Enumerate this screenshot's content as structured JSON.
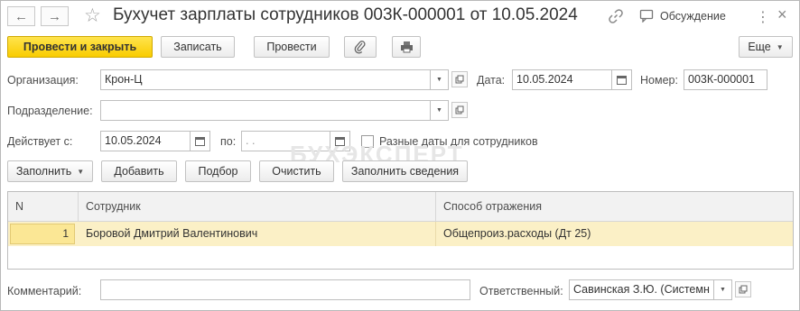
{
  "window": {
    "title": "Бухучет зарплаты сотрудников 003К-000001 от 10.05.2024",
    "discussion_label": "Обсуждение",
    "menu_dots": "⋮",
    "close_glyph": "×"
  },
  "toolbar": {
    "post_close_label": "Провести и закрыть",
    "save_label": "Записать",
    "post_label": "Провести",
    "more_label": "Еще"
  },
  "form": {
    "organization_label": "Организация:",
    "organization_value": "Крон-Ц",
    "date_label": "Дата:",
    "date_value": "10.05.2024",
    "number_label": "Номер:",
    "number_value": "003К-000001",
    "department_label": "Подразделение:",
    "department_value": "",
    "valid_from_label": "Действует с:",
    "valid_from_value": "10.05.2024",
    "valid_to_label": "по:",
    "valid_to_value": " .  .",
    "different_dates_label": "Разные даты для сотрудников",
    "different_dates_checked": false
  },
  "table_toolbar": {
    "fill_label": "Заполнить",
    "add_label": "Добавить",
    "select_label": "Подбор",
    "clear_label": "Очистить",
    "fill_info_label": "Заполнить сведения"
  },
  "table": {
    "columns": [
      "N",
      "Сотрудник",
      "Способ отражения"
    ],
    "rows": [
      {
        "n": "1",
        "employee": "Боровой Дмитрий Валентинович",
        "method": "Общепроиз.расходы (Дт 25)"
      }
    ]
  },
  "footer": {
    "comment_label": "Комментарий:",
    "comment_value": "",
    "responsible_label": "Ответственный:",
    "responsible_value": "Савинская З.Ю. (Системн"
  },
  "watermark": "БУХЭКСПЕРТ",
  "colors": {
    "primary_button": "#f9cc00",
    "selected_row": "#fbf0c6",
    "header_bg": "#f2f2f2"
  }
}
